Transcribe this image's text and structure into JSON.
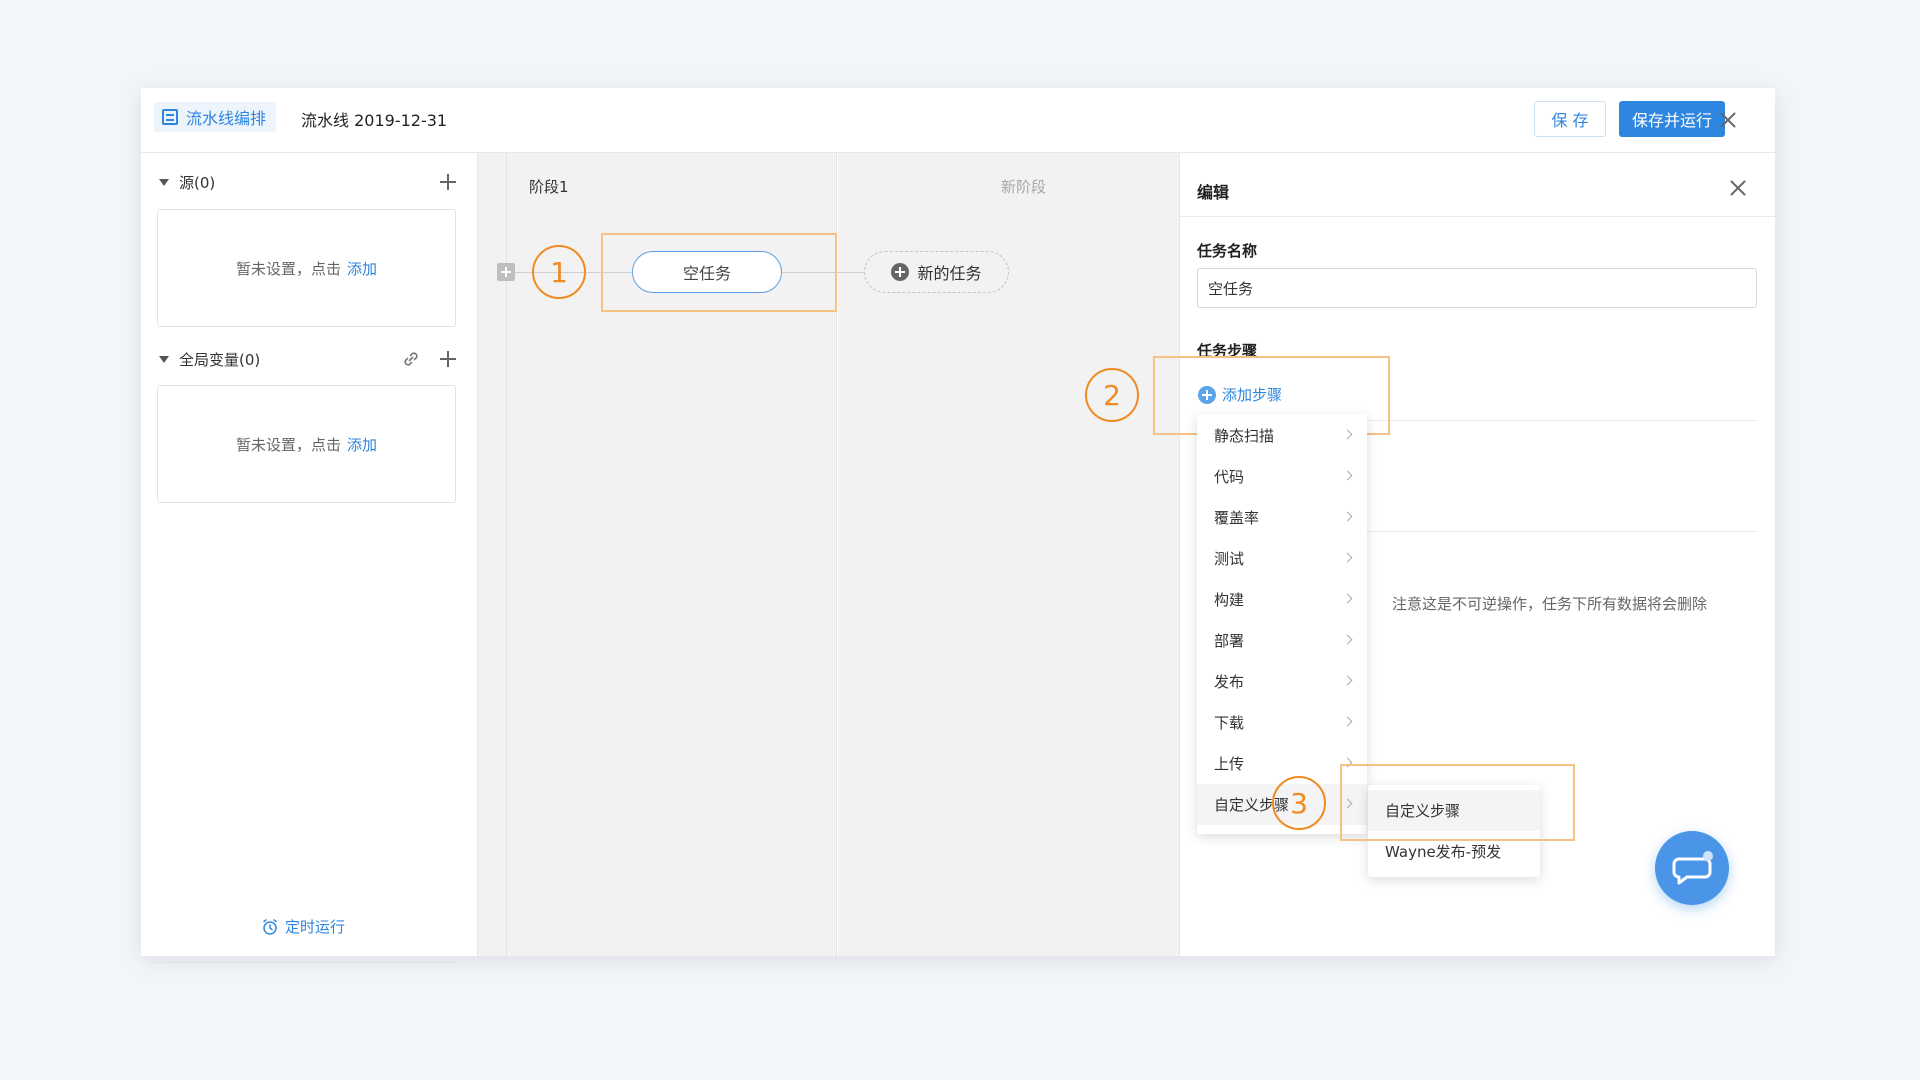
{
  "header": {
    "tag_label": "流水线编排",
    "title": "流水线 2019-12-31",
    "save_label": "保 存",
    "save_run_label": "保存并运行"
  },
  "sidebar": {
    "sources_title": "源(0)",
    "sources_empty_text": "暂未设置，点击",
    "sources_add_link": "添加",
    "globals_title": "全局变量(0)",
    "globals_empty_text": "暂未设置，点击",
    "globals_add_link": "添加",
    "timer_label": "定时运行"
  },
  "stages": {
    "stage1_title": "阶段1",
    "stage2_title": "新阶段",
    "task_label": "空任务",
    "new_task_label": "新的任务"
  },
  "edit_panel": {
    "title": "编辑",
    "task_name_label": "任务名称",
    "task_name_value": "空任务",
    "steps_label": "任务步骤",
    "add_step_label": "添加步骤",
    "warning_text": "注意这是不可逆操作，任务下所有数据将会删除"
  },
  "step_menu": {
    "items": [
      "静态扫描",
      "代码",
      "覆盖率",
      "测试",
      "构建",
      "部署",
      "发布",
      "下载",
      "上传",
      "自定义步骤"
    ],
    "active_index": 9
  },
  "sub_menu": {
    "items": [
      "自定义步骤",
      "Wayne发布-预发"
    ],
    "active_index": 0
  },
  "annotations": {
    "marker_1": "1",
    "marker_2": "2",
    "marker_3": "3",
    "color": "#f08a22"
  },
  "colors": {
    "accent": "#2f86e0",
    "annotation_box": "#f6c283"
  }
}
